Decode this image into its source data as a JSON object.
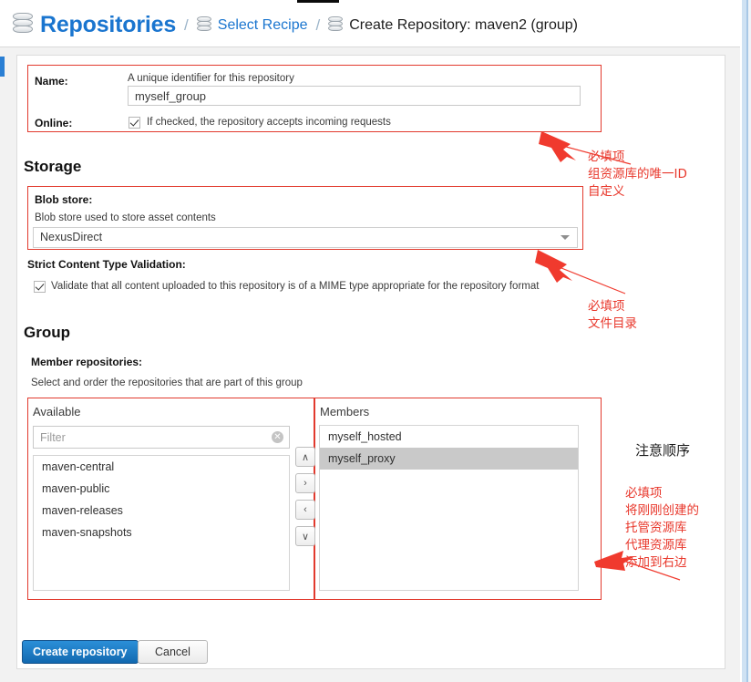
{
  "header": {
    "repo_icon": "database-icon",
    "title": "Repositories",
    "sep1": "/",
    "recipe_icon": "database-icon",
    "recipe_link": "Select Recipe",
    "sep2": "/",
    "current_icon": "database-icon",
    "current": "Create Repository: maven2 (group)"
  },
  "form": {
    "name_label": "Name:",
    "name_desc": "A unique identifier for this repository",
    "name_value": "myself_group",
    "online_label": "Online:",
    "online_desc": "If checked, the repository accepts incoming requests",
    "online_checked": true
  },
  "storage": {
    "heading": "Storage",
    "blob_label": "Blob store:",
    "blob_desc": "Blob store used to store asset contents",
    "blob_value": "NexusDirect",
    "blob_dropdown_icon": "chevron-down-icon",
    "strict_label": "Strict Content Type Validation:",
    "strict_desc": "Validate that all content uploaded to this repository is of a MIME type appropriate for the repository format",
    "strict_checked": true
  },
  "group": {
    "heading": "Group",
    "member_label": "Member repositories:",
    "member_desc": "Select and order the repositories that are part of this group",
    "available_title": "Available",
    "filter_placeholder": "Filter",
    "filter_value": "",
    "clear_icon": "clear-circle-icon",
    "available_items": [
      "maven-central",
      "maven-public",
      "maven-releases",
      "maven-snapshots"
    ],
    "members_title": "Members",
    "members_items": [
      {
        "label": "myself_hosted",
        "selected": false
      },
      {
        "label": "myself_proxy",
        "selected": true
      }
    ],
    "transfer_buttons": [
      {
        "name": "move-up-button",
        "glyph": "∧"
      },
      {
        "name": "add-to-members-button",
        "glyph": "›"
      },
      {
        "name": "remove-from-members-button",
        "glyph": "‹"
      },
      {
        "name": "move-down-button",
        "glyph": "∨"
      }
    ]
  },
  "footer": {
    "create_label": "Create repository",
    "cancel_label": "Cancel"
  },
  "annotations": {
    "a1": "必填项\n组资源库的唯一ID\n自定义",
    "a2": "必填项\n文件目录",
    "a3": "注意顺序",
    "a4": "必填项\n将刚刚创建的\n托管资源库\n代理资源库\n添加到右边"
  },
  "colors": {
    "accent_blue": "#1a75cf",
    "annotation_red": "#e8372b",
    "box_red": "#e23a2e",
    "primary_button": "#1269b0"
  }
}
